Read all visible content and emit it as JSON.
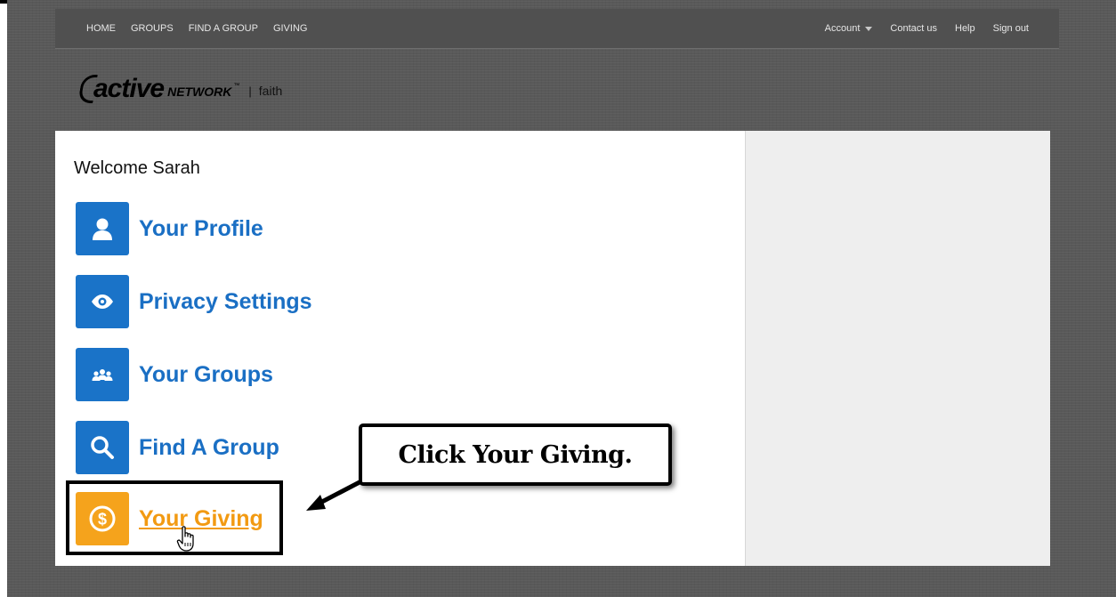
{
  "nav": {
    "left": [
      {
        "label": "HOME"
      },
      {
        "label": "GROUPS"
      },
      {
        "label": "FIND A GROUP"
      },
      {
        "label": "GIVING"
      }
    ],
    "account_label": "Account",
    "contact_label": "Contact us",
    "help_label": "Help",
    "signout_label": "Sign out"
  },
  "logo": {
    "active": "active",
    "network": "NETWORK",
    "tm": "™",
    "divider": "|",
    "faith": "faith"
  },
  "main": {
    "welcome": "Welcome Sarah",
    "items": [
      {
        "label": "Your Profile",
        "icon": "person-icon"
      },
      {
        "label": "Privacy Settings",
        "icon": "eye-icon"
      },
      {
        "label": "Your Groups",
        "icon": "group-icon"
      },
      {
        "label": "Find A Group",
        "icon": "magnifier-icon"
      },
      {
        "label": "Your Giving",
        "icon": "dollar-coin-icon"
      }
    ]
  },
  "callout": {
    "text": "Click Your Giving."
  },
  "colors": {
    "accent_blue": "#1a73c8",
    "accent_orange": "#f5a31c",
    "background": "#595959"
  }
}
